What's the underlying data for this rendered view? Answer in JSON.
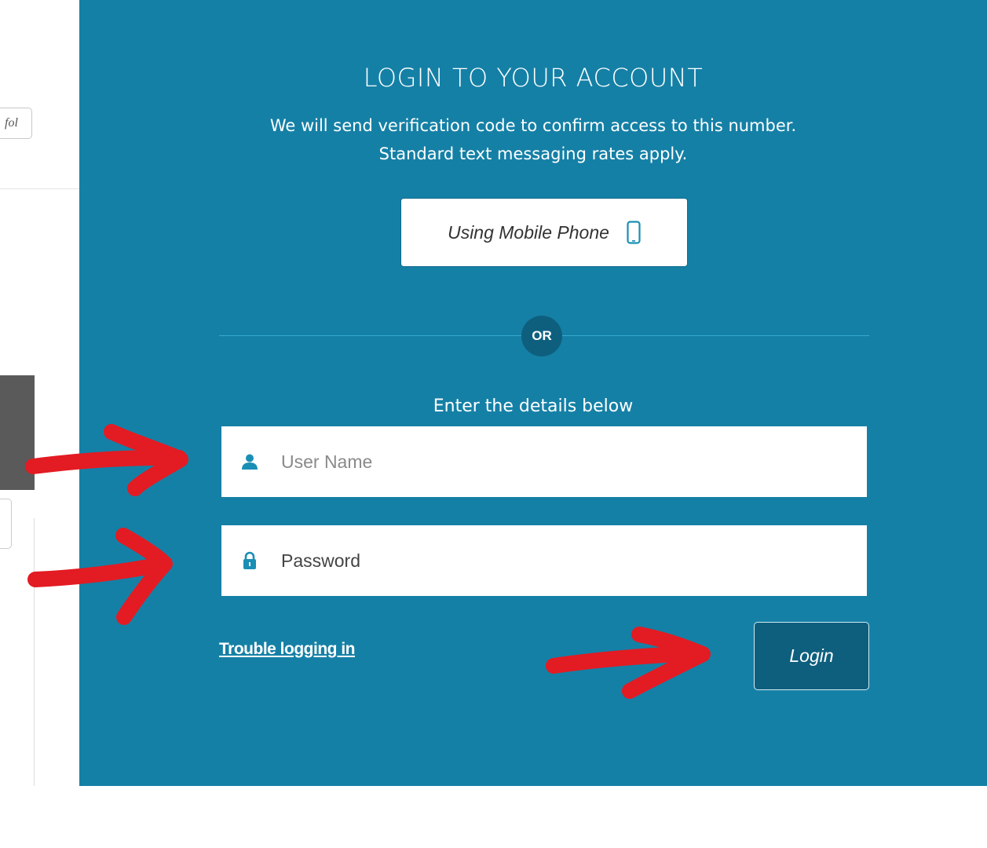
{
  "background_page": {
    "tag_text": "fol"
  },
  "login": {
    "title": "LOGIN TO YOUR ACCOUNT",
    "subtitle_line1": "We will send verification code to confirm access to this number.",
    "subtitle_line2": "Standard text messaging rates apply.",
    "mobile_button_label": "Using Mobile Phone",
    "or_label": "OR",
    "enter_details": "Enter the details below",
    "username_placeholder": "User Name",
    "password_placeholder": "Password",
    "trouble_link": "Trouble logging in",
    "login_button": "Login"
  },
  "icons": {
    "phone": "mobile-phone-icon",
    "user": "user-icon",
    "lock": "lock-icon"
  },
  "colors": {
    "panel_bg": "#1580a6",
    "dark_accent": "#0e5f7e",
    "icon_teal": "#1a8fb5",
    "annotation_red": "#e31b23"
  }
}
